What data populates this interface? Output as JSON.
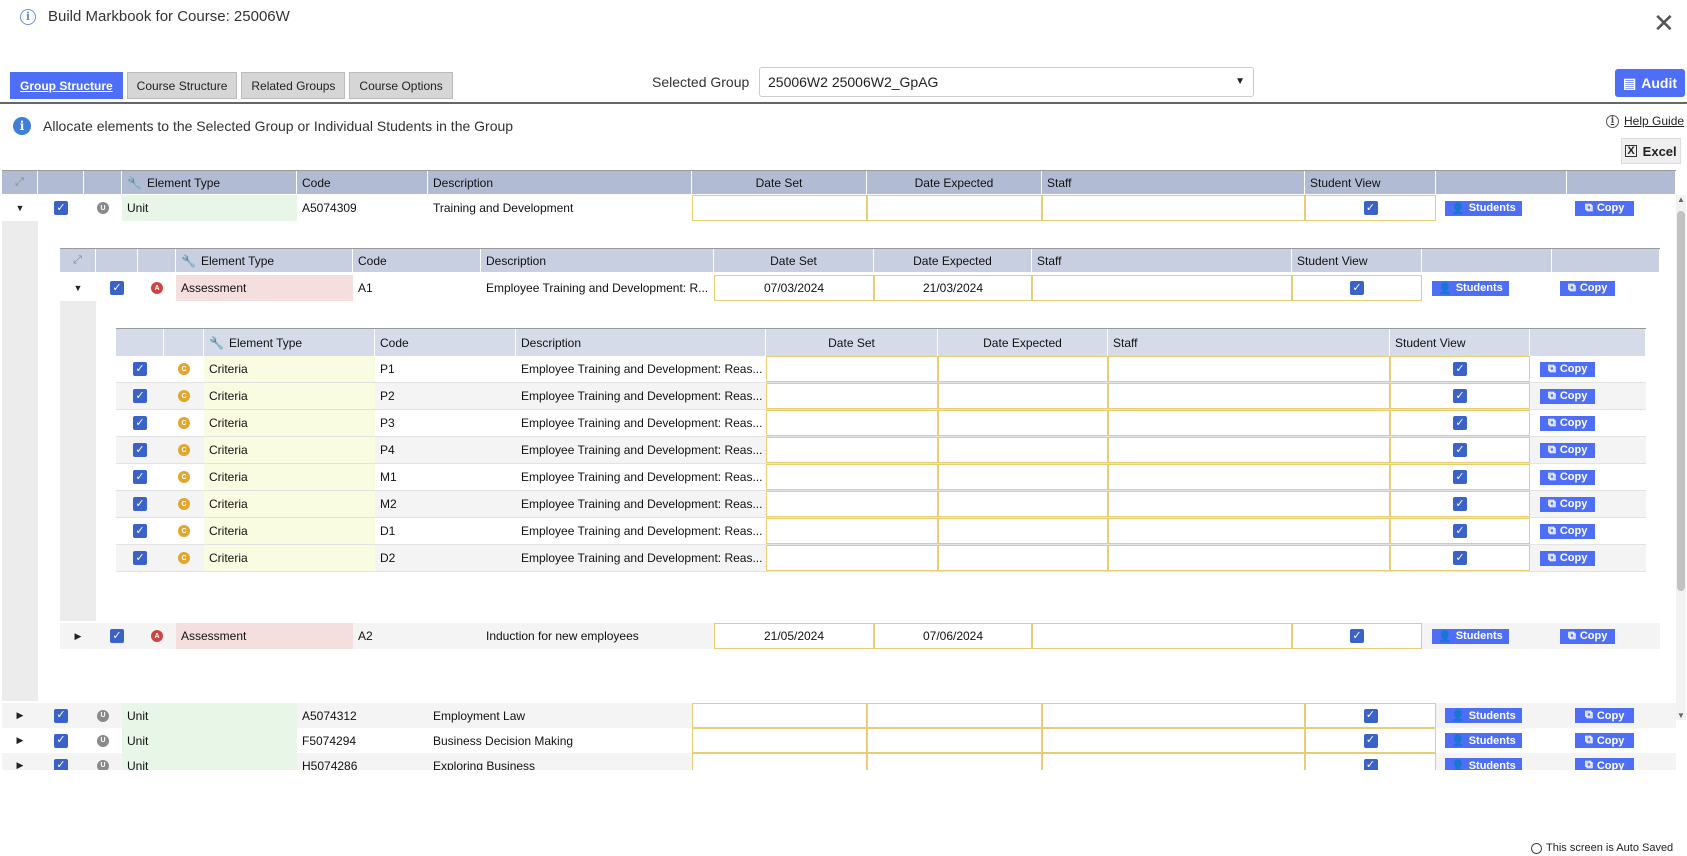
{
  "window": {
    "title": "Build Markbook for Course: 25006W"
  },
  "tabs": [
    "Group Structure",
    "Course Structure",
    "Related Groups",
    "Course Options"
  ],
  "selected_group": {
    "label": "Selected Group",
    "value": "25006W2 25006W2_GpAG"
  },
  "audit_label": "Audit",
  "allocate_text": "Allocate elements to the Selected Group or Individual Students in the Group",
  "help_label": "Help Guide",
  "excel_label": "Excel",
  "columns": {
    "element_type": "Element Type",
    "code": "Code",
    "description": "Description",
    "date_set": "Date Set",
    "date_expected": "Date Expected",
    "staff": "Staff",
    "student_view": "Student View"
  },
  "buttons": {
    "students": "Students",
    "copy": "Copy"
  },
  "units": [
    {
      "type": "Unit",
      "code": "A5074309",
      "description": "Training and Development"
    },
    {
      "type": "Unit",
      "code": "A5074312",
      "description": "Employment Law"
    },
    {
      "type": "Unit",
      "code": "F5074294",
      "description": "Business Decision Making"
    },
    {
      "type": "Unit",
      "code": "H5074286",
      "description": "Exploring Business"
    }
  ],
  "assessments": [
    {
      "type": "Assessment",
      "code": "A1",
      "description": "Employee Training and Development: R...",
      "date_set": "07/03/2024",
      "date_expected": "21/03/2024"
    },
    {
      "type": "Assessment",
      "code": "A2",
      "description": "Induction for new employees",
      "date_set": "21/05/2024",
      "date_expected": "07/06/2024"
    }
  ],
  "criteria": [
    {
      "type": "Criteria",
      "code": "P1",
      "description": "Employee Training and Development: Reas..."
    },
    {
      "type": "Criteria",
      "code": "P2",
      "description": "Employee Training and Development: Reas..."
    },
    {
      "type": "Criteria",
      "code": "P3",
      "description": "Employee Training and Development: Reas..."
    },
    {
      "type": "Criteria",
      "code": "P4",
      "description": "Employee Training and Development: Reas..."
    },
    {
      "type": "Criteria",
      "code": "M1",
      "description": "Employee Training and Development: Reas..."
    },
    {
      "type": "Criteria",
      "code": "M2",
      "description": "Employee Training and Development: Reas..."
    },
    {
      "type": "Criteria",
      "code": "D1",
      "description": "Employee Training and Development: Reas..."
    },
    {
      "type": "Criteria",
      "code": "D2",
      "description": "Employee Training and Development: Reas..."
    }
  ],
  "badges": {
    "unit": "U",
    "assessment": "A",
    "criteria": "C"
  },
  "auto_saved": "This screen is Auto Saved",
  "colors": {
    "accent": "#4f6ef7",
    "header": "#b1bbd3",
    "unit_bg": "#e7f6e6",
    "assessment_bg": "#f5dede",
    "criteria_bg": "#f9fce0",
    "date_border": "#e8cd73"
  }
}
